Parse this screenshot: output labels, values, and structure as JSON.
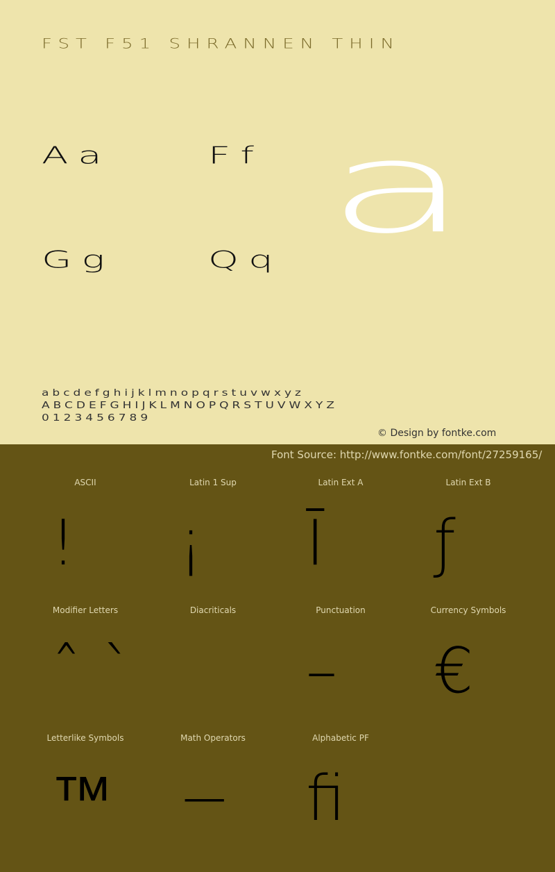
{
  "title": "FST F51 SHRANNEN THIN",
  "samples": [
    "Aa",
    "Ff",
    "Gg",
    "Qq"
  ],
  "big_glyph": "a",
  "alphabet": {
    "lower": "abcdefghijklmnopqrstuvwxyz",
    "upper": "ABCDEFGHIJKLMNOPQRSTUVWXYZ",
    "digits": "0123456789"
  },
  "credit": "© Design by fontke.com",
  "source": "Font Source: http://www.fontke.com/font/27259165/",
  "categories": [
    {
      "label": "ASCII",
      "glyph": "!"
    },
    {
      "label": "Latin 1 Sup",
      "glyph": "¡"
    },
    {
      "label": "Latin Ext A",
      "glyph": "Ī"
    },
    {
      "label": "Latin Ext B",
      "glyph": "ƒ"
    },
    {
      "label": "Modifier Letters",
      "glyph": "ˆ ˋ"
    },
    {
      "label": "Diacriticals",
      "glyph": ""
    },
    {
      "label": "Punctuation",
      "glyph": "–"
    },
    {
      "label": "Currency Symbols",
      "glyph": "€"
    },
    {
      "label": "Letterlike Symbols",
      "glyph": "™"
    },
    {
      "label": "Math Operators",
      "glyph": "−"
    },
    {
      "label": "Alphabetic PF",
      "glyph": "ﬁ"
    }
  ],
  "colors": {
    "top_bg": "#EEE4AC",
    "bottom_bg": "#645415"
  }
}
